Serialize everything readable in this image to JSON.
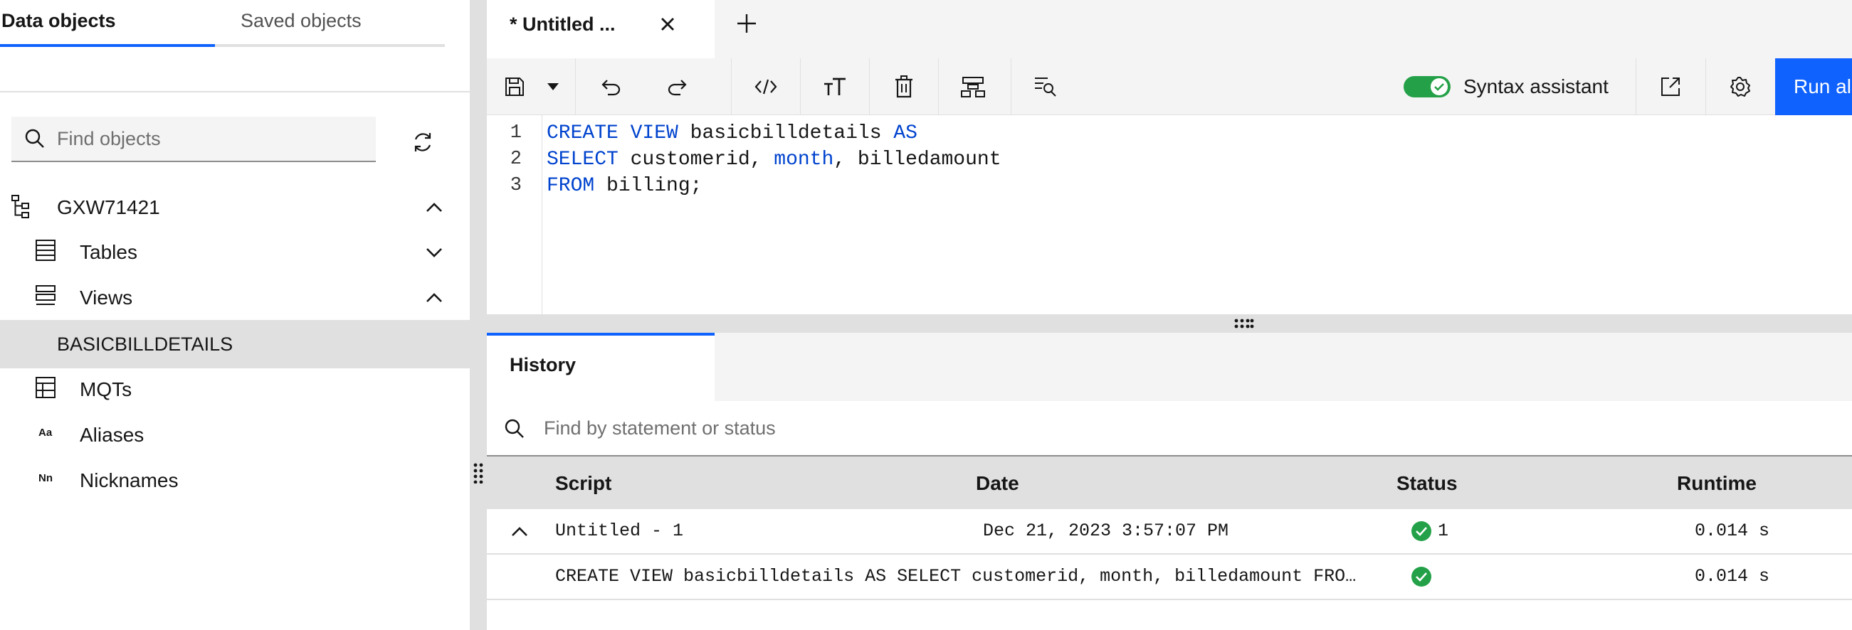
{
  "left_panel": {
    "tabs": {
      "data_objects": "Data objects",
      "saved_objects": "Saved objects"
    },
    "search": {
      "placeholder": "Find objects"
    },
    "tree": {
      "database": "GXW71421",
      "tables": "Tables",
      "views": "Views",
      "selected_view": "BASICBILLDETAILS",
      "mqts": "MQTs",
      "aliases": "Aliases",
      "aliases_icon_text": "Aa",
      "nicknames": "Nicknames",
      "nicknames_icon_text": "Nn"
    }
  },
  "editor": {
    "tab_label": "* Untitled ...",
    "toolbar": {
      "syntax_assistant_label": "Syntax assistant",
      "syntax_assistant_on": true,
      "run_label": "Run al"
    },
    "line_numbers": [
      "1",
      "2",
      "3"
    ],
    "code": {
      "line1": {
        "kw1": "CREATE VIEW",
        "t1": " basicbilldetails ",
        "kw2": "AS"
      },
      "line2": {
        "kw1": "SELECT",
        "t1": " customerid, ",
        "kw2": "month",
        "t2": ", billedamount"
      },
      "line3": {
        "kw1": "FROM",
        "t1": " billing;"
      }
    }
  },
  "history": {
    "tab_label": "History",
    "search_placeholder": "Find by statement or status",
    "columns": {
      "script": "Script",
      "date": "Date",
      "status": "Status",
      "runtime": "Runtime"
    },
    "rows": [
      {
        "script": "Untitled - 1",
        "date": "Dec 21, 2023 3:57:07 PM",
        "status_count": "1",
        "runtime": "0.014 s"
      },
      {
        "script": "CREATE VIEW basicbilldetails AS SELECT customerid, month, billedamount FRO…",
        "date": "",
        "status_count": "",
        "runtime": "0.014 s"
      }
    ]
  },
  "colors": {
    "accent": "#0f62fe",
    "success": "#24a148",
    "keyword": "#0043ce"
  }
}
